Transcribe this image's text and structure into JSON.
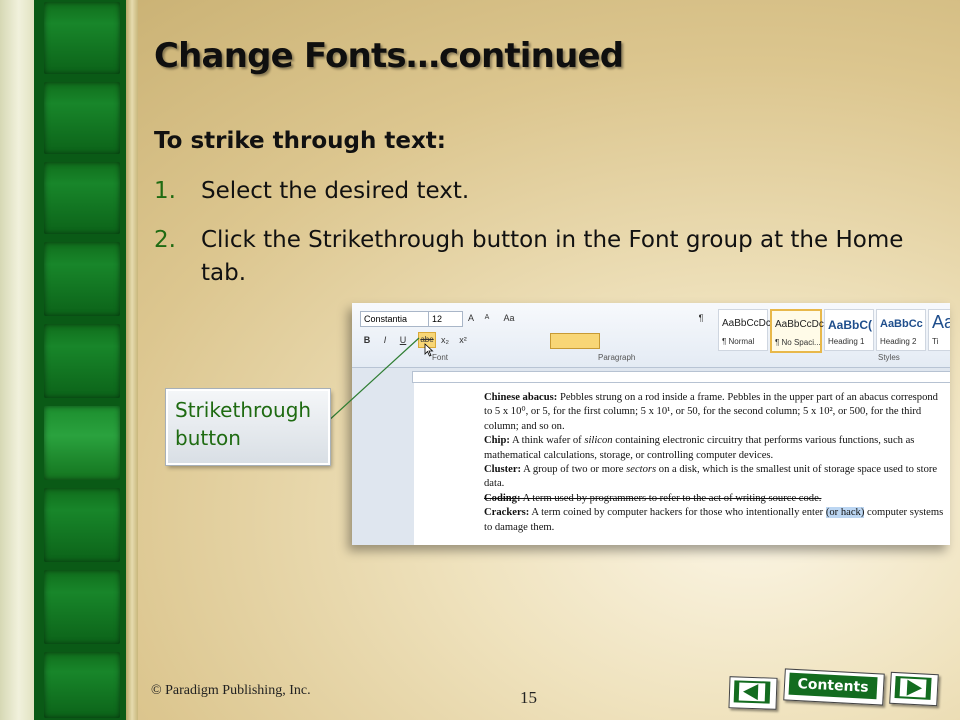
{
  "slide": {
    "title": "Change Fonts…continued",
    "subheading": "To strike through text:",
    "steps": [
      {
        "number": "1.",
        "text": "Select the desired text."
      },
      {
        "number": "2.",
        "text": "Click the Strikethrough button in the Font group at the Home tab."
      }
    ],
    "callout": {
      "line1": "Strikethrough",
      "line2": "button"
    },
    "footer": {
      "copyright": "© Paradigm Publishing, Inc.",
      "page_number": "15"
    },
    "navigation": {
      "contents_label": "Contents",
      "back_icon": "triangle-left",
      "forward_icon": "triangle-right"
    },
    "colors": {
      "accent_green": "#1f6b12",
      "stripe_green": "#0a5a16",
      "highlight_yellow": "#f8d676"
    }
  },
  "word_screenshot": {
    "font_name": "Constantia",
    "font_size": "12",
    "group_labels": {
      "font": "Font",
      "paragraph": "Paragraph",
      "styles": "Styles"
    },
    "styles": [
      {
        "sample": "AaBbCcDc",
        "name": "¶ Normal"
      },
      {
        "sample": "AaBbCcDc",
        "name": "¶ No Spaci..."
      },
      {
        "sample": "AaBbC(",
        "name": "Heading 1"
      },
      {
        "sample": "AaBbCc",
        "name": "Heading 2"
      },
      {
        "sample": "Aa",
        "name": "Ti"
      }
    ],
    "ribbon_buttons": {
      "bold": "B",
      "italic": "I",
      "underline": "U",
      "strikethrough": "abe",
      "subscript": "x₂",
      "superscript": "x²",
      "grow": "A",
      "shrink": "A",
      "case": "Aa",
      "pilcrow": "¶"
    },
    "document": {
      "chinese_abacus_term": "Chinese abacus:",
      "chinese_abacus_text": " Pebbles strung on a rod inside a frame. Pebbles in the upper part of an abacus correspond to 5 x 10⁰, or 5, for the first column; 5 x 10¹, or 50, for the second column; 5 x 10², or 500, for the third column; and so on.",
      "chip_term": "Chip:",
      "chip_text_a": " A think wafer of ",
      "chip_italic": "silicon",
      "chip_text_b": "  containing electronic circuitry that performs various functions, such as mathematical calculations, storage, or controlling computer devices.",
      "cluster_term": "Cluster:",
      "cluster_text_a": " A group of two or more ",
      "cluster_italic": "sectors",
      "cluster_text_b": "  on a disk, which is the smallest unit of storage space used to store data.",
      "coding_term": "Coding:",
      "coding_text": " A term used by programmers to refer to the act of writing source code.",
      "crackers_term": "Crackers:",
      "crackers_text_a": " A term coined by computer hackers for those who intentionally enter ",
      "crackers_selected": "(or hack)",
      "crackers_text_b": " computer systems to damage them."
    }
  }
}
